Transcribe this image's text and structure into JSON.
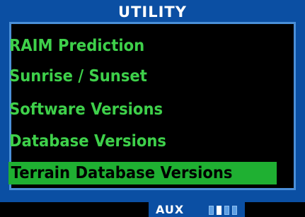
{
  "header": {
    "title": "UTILITY"
  },
  "menu": {
    "items": [
      {
        "label": "RAIM Prediction",
        "selected": false
      },
      {
        "label": "Sunrise / Sunset",
        "selected": false
      },
      {
        "label": "Software Versions",
        "selected": false
      },
      {
        "label": "Database Versions",
        "selected": false
      },
      {
        "label": "Terrain Database Versions",
        "selected": true
      }
    ]
  },
  "status_bar": {
    "mode_label": "AUX",
    "page_indicator": {
      "total_pages": 4,
      "current_page": 2
    }
  },
  "colors": {
    "panel_blue": "#0b4fa3",
    "frame_blue": "#4a8fd8",
    "menu_text_green": "#3ed04a",
    "selection_green": "#1fb032",
    "title_text": "#ffffff",
    "background": "#000000"
  }
}
